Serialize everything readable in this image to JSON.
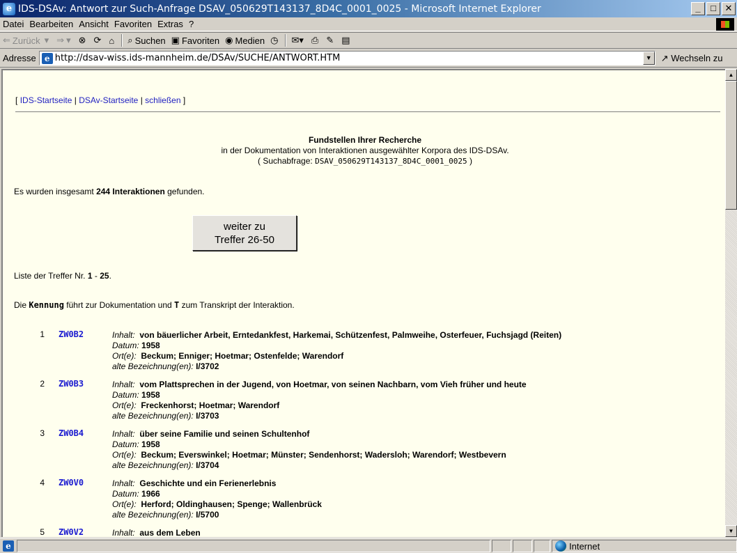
{
  "window": {
    "title": "IDS-DSAv: Antwort zur Such-Anfrage DSAV_050629T143137_8D4C_0001_0025 - Microsoft Internet Explorer",
    "minimize": "_",
    "maximize": "□",
    "close": "✕"
  },
  "menu": [
    "Datei",
    "Bearbeiten",
    "Ansicht",
    "Favoriten",
    "Extras",
    "?"
  ],
  "toolbar": {
    "back": "Zurück",
    "search": "Suchen",
    "favorites": "Favoriten",
    "media": "Medien"
  },
  "address": {
    "label": "Adresse",
    "url": "http://dsav-wiss.ids-mannheim.de/DSAv/SUCHE/ANTWORT.HTM",
    "go": "Wechseln zu"
  },
  "page": {
    "nav": {
      "open": "[",
      "link1": "IDS-Startseite",
      "sep1": "|",
      "link2": "DSAv-Startseite",
      "sep2": "|",
      "link3": "schließen",
      "close": "]"
    },
    "heading_title": "Fundstellen Ihrer Recherche",
    "heading_sub": "in der Dokumentation von Interaktionen ausgewählter Korpora des IDS-DSAv.",
    "query_label": "( Suchabfrage:",
    "query_id": "DSAV_050629T143137_8D4C_0001_0025",
    "query_close": ")",
    "found_pre": "Es wurden insgesamt",
    "found_count": "244 Interaktionen",
    "found_post": "gefunden.",
    "next_line1": "weiter zu",
    "next_line2": "Treffer 26-50",
    "list_pre": "Liste der Treffer Nr.",
    "list_from": "1",
    "list_dash": "-",
    "list_to": "25",
    "list_dot": ".",
    "kennung_pre": "Die",
    "kennung_word": "Kennung",
    "kennung_mid": "führt zur Dokumentation und",
    "kennung_t": "T",
    "kennung_post": "zum Transkript der Interaktion."
  },
  "labels": {
    "inhalt": "Inhalt:",
    "datum": "Datum:",
    "orte": "Ort(e):",
    "alte": "alte Bezeichnung(en):"
  },
  "hits": [
    {
      "num": "1",
      "id": "ZW0B2",
      "inhalt": "von bäuerlicher Arbeit, Erntedankfest, Harkemai, Schützenfest, Palmweihe, Osterfeuer, Fuchsjagd (Reiten)",
      "datum": "1958",
      "orte": "Beckum; Enniger; Hoetmar; Ostenfelde; Warendorf",
      "alte": "I/3702"
    },
    {
      "num": "2",
      "id": "ZW0B3",
      "inhalt": "vom Plattsprechen in der Jugend, von Hoetmar, von seinen Nachbarn, vom Vieh früher und heute",
      "datum": "1958",
      "orte": "Freckenhorst; Hoetmar; Warendorf",
      "alte": "I/3703"
    },
    {
      "num": "3",
      "id": "ZW0B4",
      "inhalt": "über seine Familie und seinen Schultenhof",
      "datum": "1958",
      "orte": "Beckum; Everswinkel; Hoetmar; Münster; Sendenhorst; Wadersloh; Warendorf; Westbevern",
      "alte": "I/3704"
    },
    {
      "num": "4",
      "id": "ZW0V0",
      "inhalt": "Geschichte und ein Ferienerlebnis",
      "datum": "1966",
      "orte": "Herford; Oldinghausen; Spenge; Wallenbrück",
      "alte": "I/5700"
    },
    {
      "num": "5",
      "id": "ZW0V2",
      "inhalt": "aus dem Leben",
      "datum": "",
      "orte": "",
      "alte": ""
    }
  ],
  "status": {
    "zone": "Internet"
  }
}
